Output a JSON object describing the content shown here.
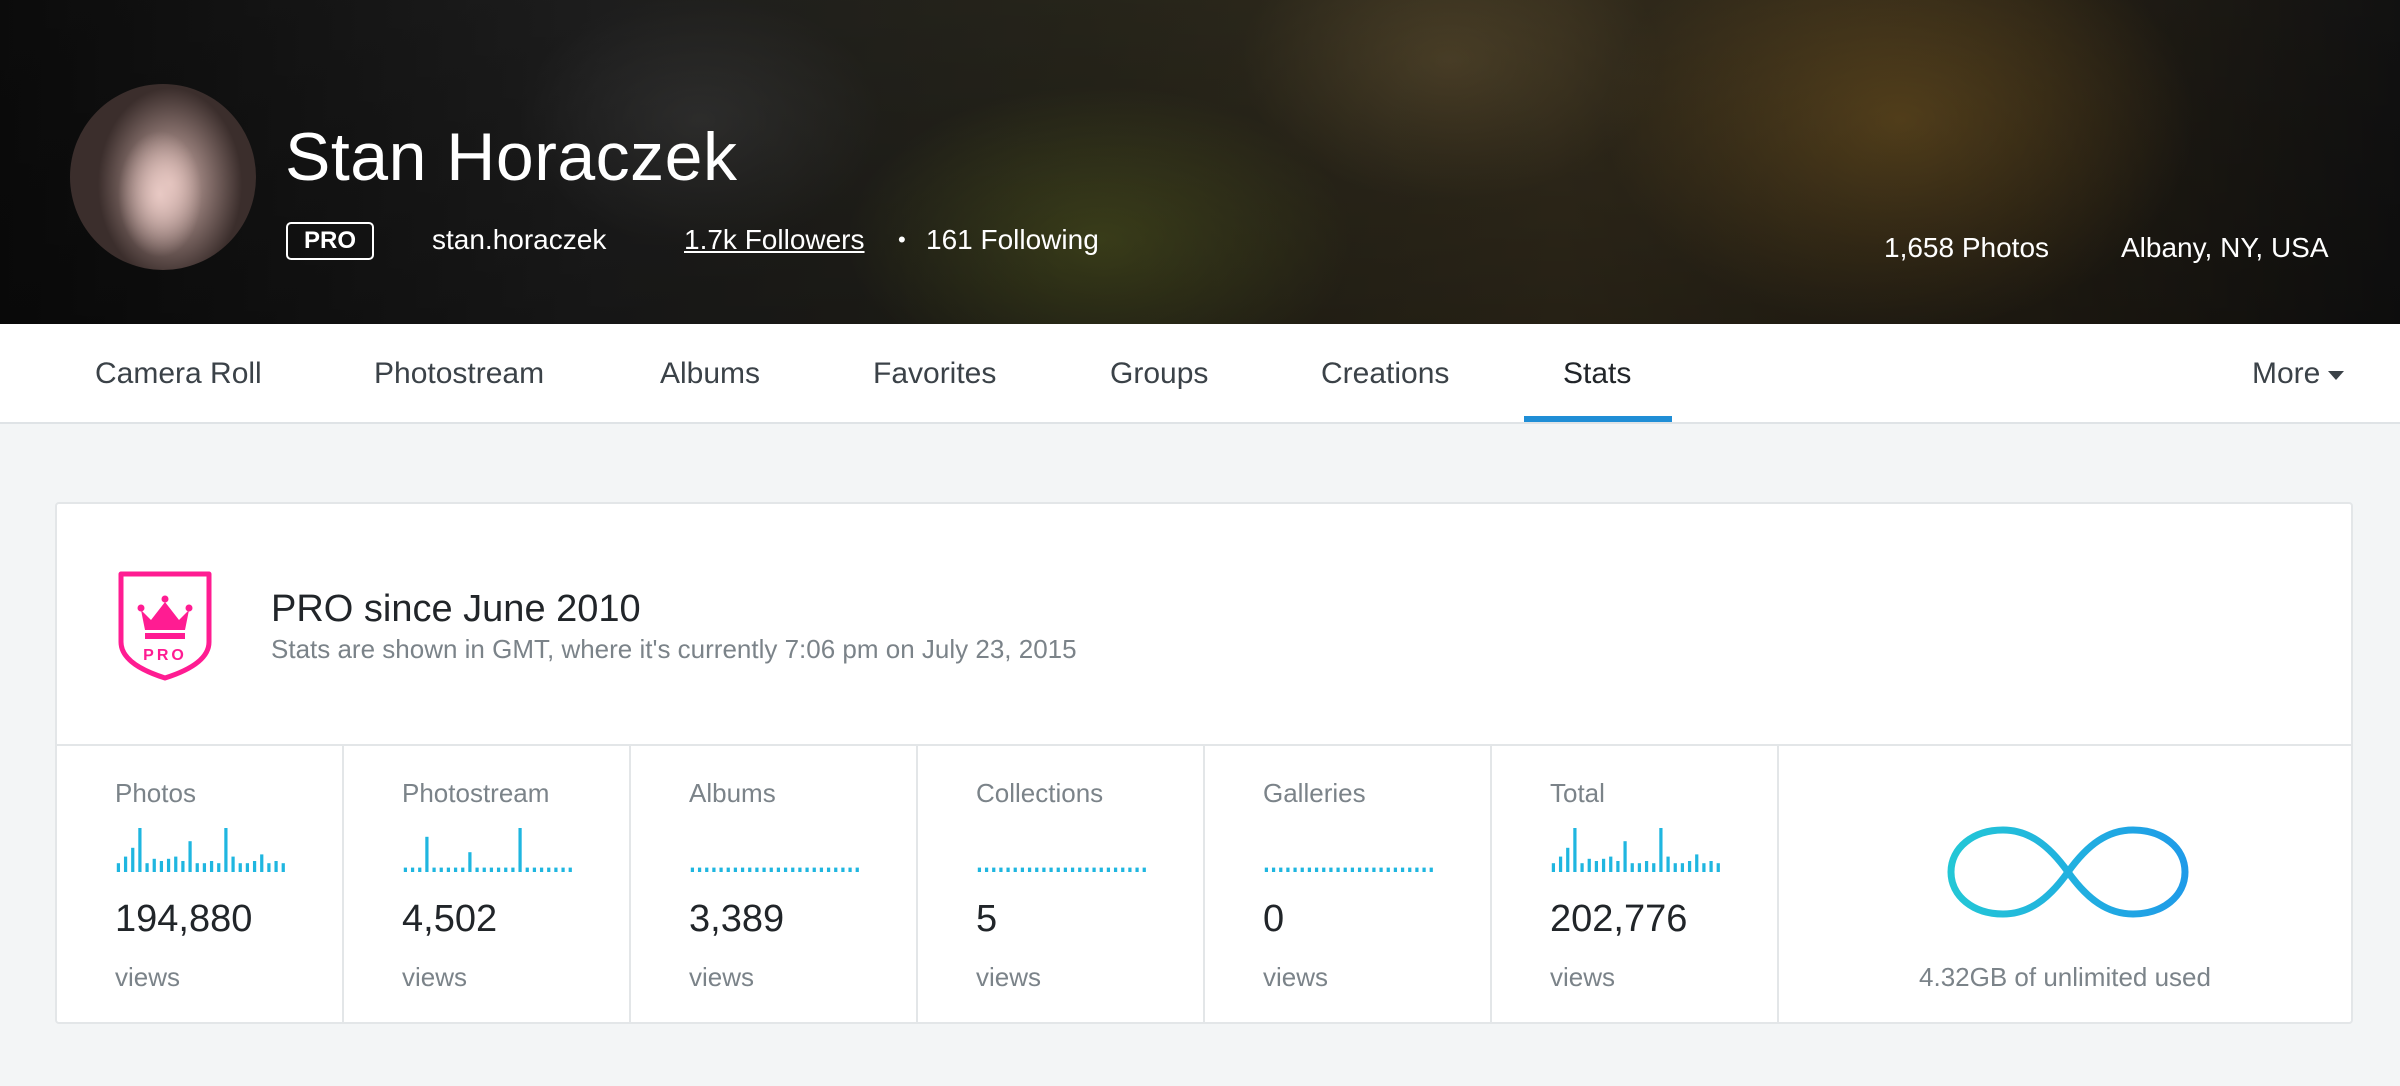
{
  "header": {
    "name": "Stan Horaczek",
    "pro_label": "PRO",
    "username": "stan.horaczek",
    "followers": "1.7k Followers",
    "separator": "•",
    "following": "161 Following",
    "photos": "1,658 Photos",
    "location": "Albany, NY, USA"
  },
  "nav": {
    "tabs": [
      "Camera Roll",
      "Photostream",
      "Albums",
      "Favorites",
      "Groups",
      "Creations",
      "Stats"
    ],
    "active_tab": "Stats",
    "more_label": "More"
  },
  "stats_card": {
    "title": "PRO since June 2010",
    "subtitle": "Stats are shown in GMT, where it's currently 7:06 pm on July 23, 2015",
    "shield_text": "PRO",
    "items": [
      {
        "label": "Photos",
        "value": "194,880",
        "unit": "views",
        "spark": [
          0.2,
          0.35,
          0.55,
          1,
          0.2,
          0.3,
          0.25,
          0.3,
          0.35,
          0.25,
          0.7,
          0.2,
          0.2,
          0.25,
          0.2,
          1,
          0.35,
          0.2,
          0.2,
          0.25,
          0.4,
          0.2,
          0.25,
          0.2
        ]
      },
      {
        "label": "Photostream",
        "value": "4,502",
        "unit": "views",
        "spark": [
          0.1,
          0.1,
          0.1,
          0.8,
          0.1,
          0.1,
          0.1,
          0.1,
          0.1,
          0.45,
          0.1,
          0.1,
          0.1,
          0.1,
          0.1,
          0.1,
          1,
          0.1,
          0.1,
          0.1,
          0.1,
          0.1,
          0.1,
          0.1
        ]
      },
      {
        "label": "Albums",
        "value": "3,389",
        "unit": "views",
        "spark": [
          0.1,
          0.1,
          0.1,
          0.1,
          0.1,
          0.1,
          0.1,
          0.1,
          0.1,
          0.1,
          0.1,
          0.1,
          0.1,
          0.1,
          0.1,
          0.1,
          0.1,
          0.1,
          0.1,
          0.1,
          0.1,
          0.1,
          0.1,
          0.1
        ]
      },
      {
        "label": "Collections",
        "value": "5",
        "unit": "views",
        "spark": [
          0.1,
          0.1,
          0.1,
          0.1,
          0.1,
          0.1,
          0.1,
          0.1,
          0.1,
          0.1,
          0.1,
          0.1,
          0.1,
          0.1,
          0.1,
          0.1,
          0.1,
          0.1,
          0.1,
          0.1,
          0.1,
          0.1,
          0.1,
          0.1
        ]
      },
      {
        "label": "Galleries",
        "value": "0",
        "unit": "views",
        "spark": [
          0.1,
          0.1,
          0.1,
          0.1,
          0.1,
          0.1,
          0.1,
          0.1,
          0.1,
          0.1,
          0.1,
          0.1,
          0.1,
          0.1,
          0.1,
          0.1,
          0.1,
          0.1,
          0.1,
          0.1,
          0.1,
          0.1,
          0.1,
          0.1
        ]
      },
      {
        "label": "Total",
        "value": "202,776",
        "unit": "views",
        "spark": [
          0.2,
          0.35,
          0.55,
          1,
          0.2,
          0.3,
          0.25,
          0.3,
          0.35,
          0.25,
          0.7,
          0.2,
          0.2,
          0.25,
          0.2,
          1,
          0.35,
          0.2,
          0.2,
          0.25,
          0.4,
          0.2,
          0.25,
          0.2
        ]
      }
    ],
    "storage_text": "4.32GB of unlimited used"
  },
  "colors": {
    "accent": "#1f8ed6",
    "spark": "#1fb6e0",
    "pro_pink": "#ff1c92",
    "infinity_start": "#23c7d6",
    "infinity_end": "#1f9be8"
  }
}
